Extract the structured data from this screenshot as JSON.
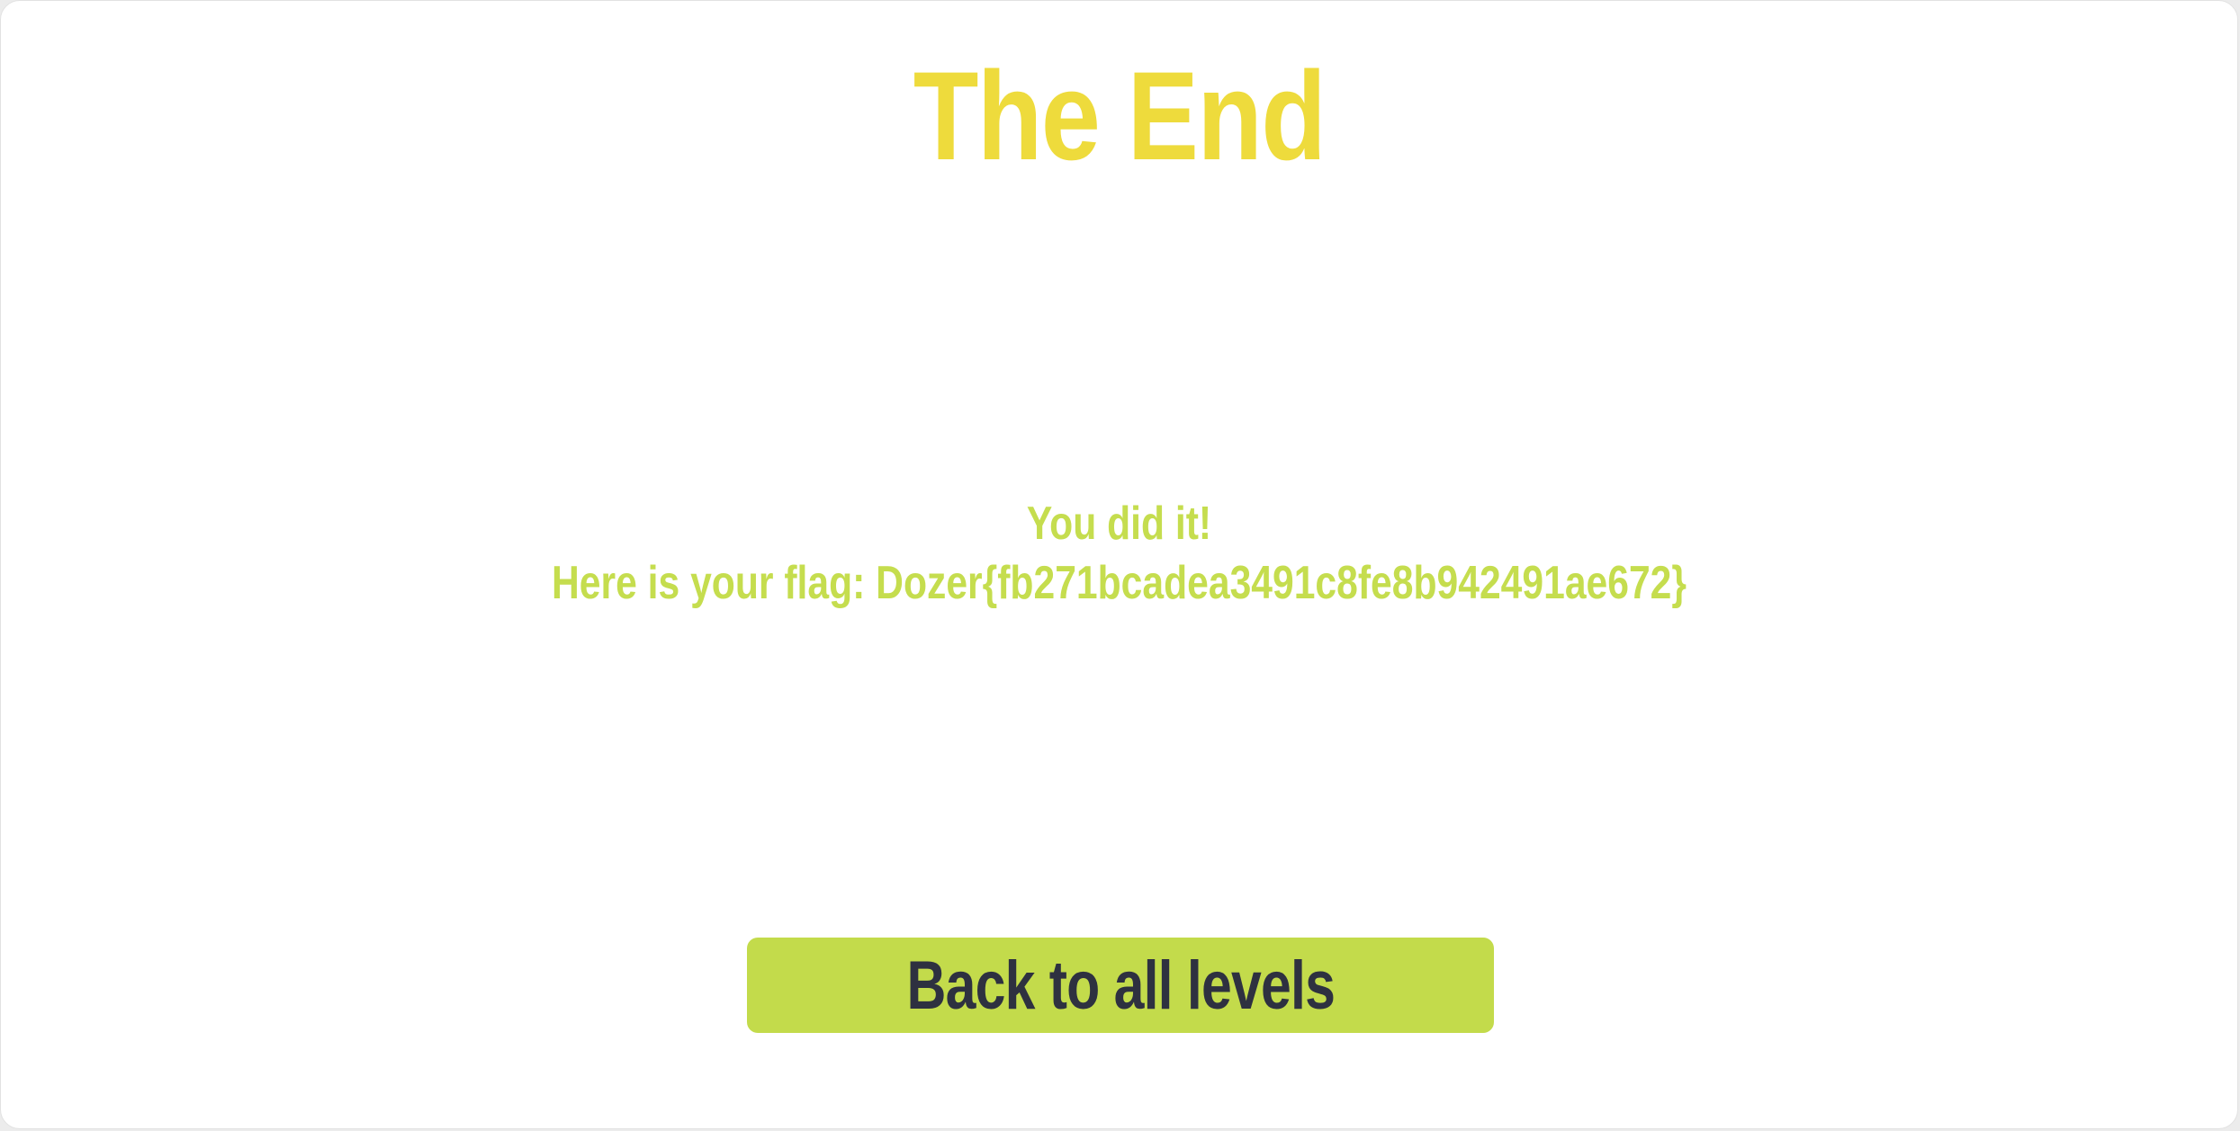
{
  "page": {
    "title": "The End",
    "message_line1": "You did it!",
    "message_line2": "Here is your flag: Dozer{fb271bcadea3491c8fe8b942491ae672}"
  },
  "actions": {
    "back_label": "Back to all levels"
  },
  "colors": {
    "title": "#eedb3c",
    "message": "#c5dd4e",
    "button_bg": "#c3db4b",
    "button_text": "#2e3140",
    "background": "#ffffff"
  }
}
